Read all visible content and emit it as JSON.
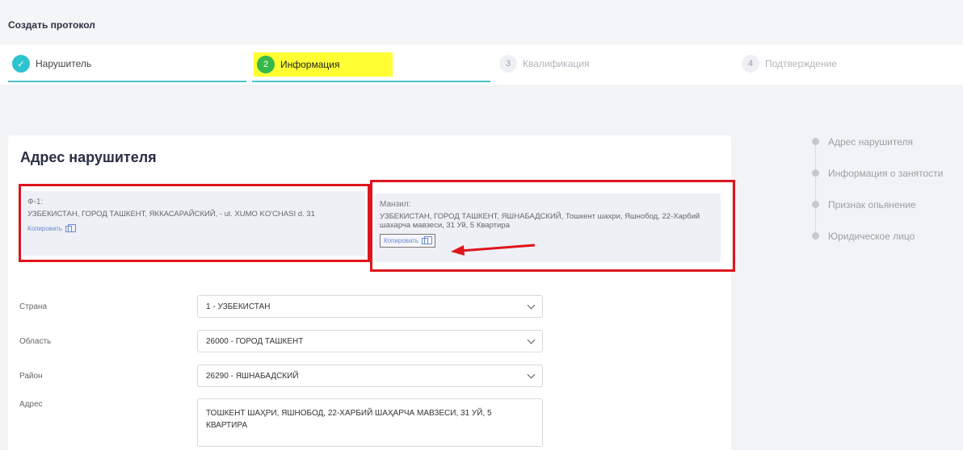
{
  "page": {
    "title": "Создать протокол"
  },
  "steps": [
    {
      "num": "✓",
      "label": "Нарушитель",
      "state": "done"
    },
    {
      "num": "2",
      "label": "Информация",
      "state": "active"
    },
    {
      "num": "3",
      "label": "Квалификация",
      "state": "pending"
    },
    {
      "num": "4",
      "label": "Подтверждение",
      "state": "pending"
    }
  ],
  "section": {
    "heading": "Адрес нарушителя"
  },
  "address_f1": {
    "caption": "Ф-1:",
    "value": "УЗБЕКИСТАН, ГОРОД ТАШКЕНТ, ЯККАСАРАЙСКИЙ, - ul. XUMO KO'CHASI d. 31",
    "copy_label": "Копировать"
  },
  "address_manzil": {
    "caption": "Манзил:",
    "value": "УЗБЕКИСТАН, ГОРОД ТАШКЕНТ, ЯШНАБАДСКИЙ, Тошкент шахри, Яшнобод, 22-Харбий шахарча мавзеси, 31 Уй, 5 Квартира",
    "copy_label": "Копировать"
  },
  "form": {
    "country": {
      "label": "Страна",
      "value": "1 - УЗБЕКИСТАН"
    },
    "region": {
      "label": "Область",
      "value": "26000 - ГОРОД ТАШКЕНТ"
    },
    "district": {
      "label": "Район",
      "value": "26290 - ЯШНАБАДСКИЙ"
    },
    "address": {
      "label": "Адрес",
      "value": "ТОШКЕНТ ШАҲРИ, ЯШНОБОД, 22-ХАРБИЙ ШАҲАРЧА МАВЗЕСИ, 31 УЙ, 5 КВАРТИРА"
    }
  },
  "toc": {
    "items": [
      "Адрес нарушителя",
      "Информация о занятости",
      "Признак опьянение",
      "Юридическое лицо"
    ]
  },
  "colors": {
    "accent": "#2ec4cf",
    "active_step": "#37b84a",
    "highlight": "#ffff33",
    "annotation": "#e0141c"
  },
  "icons": {
    "done": "check-icon",
    "copy": "copy-icon",
    "select": "chevron-down-icon"
  }
}
